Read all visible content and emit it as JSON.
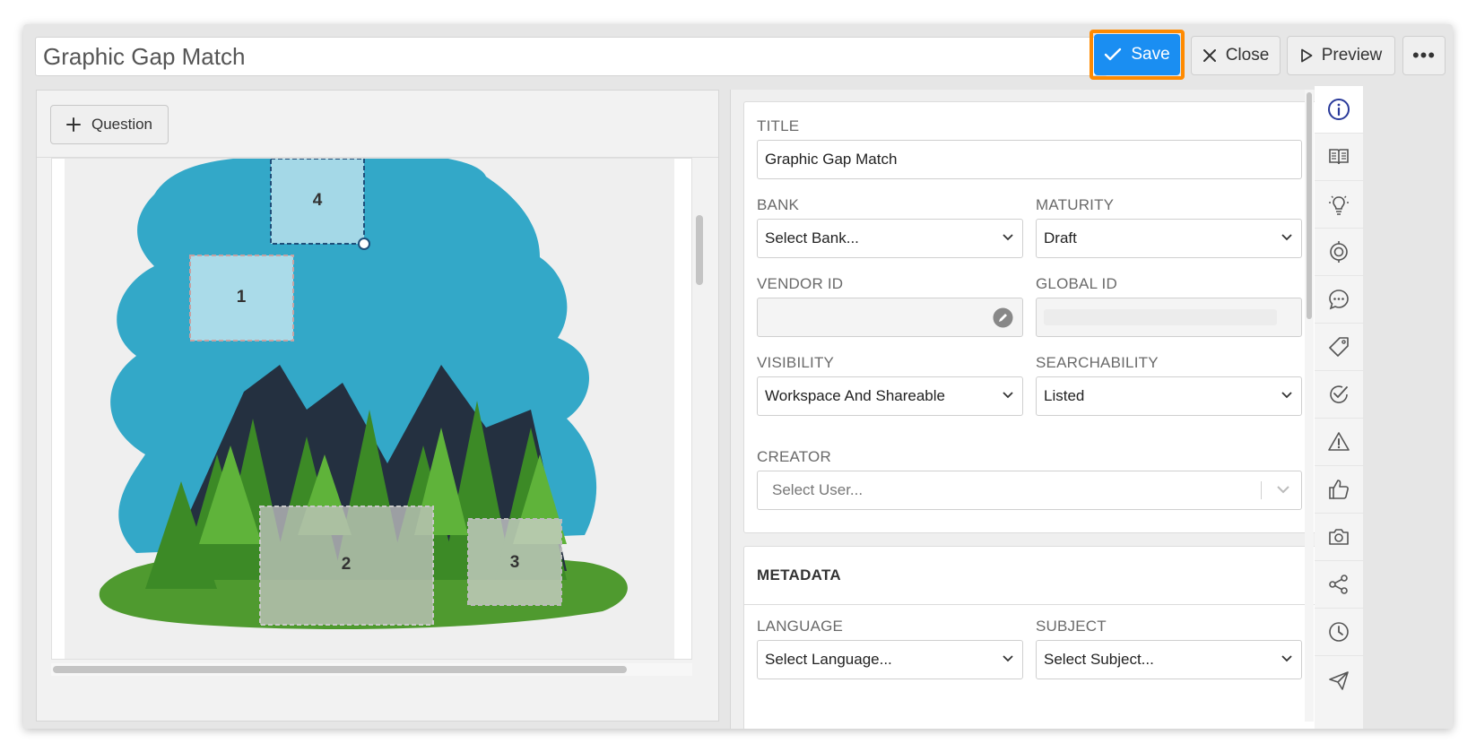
{
  "header": {
    "title": "Graphic Gap Match",
    "save_label": "Save",
    "close_label": "Close",
    "preview_label": "Preview",
    "more_label": "•••"
  },
  "editor": {
    "add_question_label": "Question",
    "hotspots": [
      "4",
      "1",
      "2",
      "3"
    ]
  },
  "properties": {
    "title_label": "TITLE",
    "title_value": "Graphic Gap Match",
    "bank_label": "BANK",
    "bank_value": "Select Bank...",
    "maturity_label": "MATURITY",
    "maturity_value": "Draft",
    "vendor_id_label": "VENDOR ID",
    "vendor_id_value": "",
    "global_id_label": "GLOBAL ID",
    "visibility_label": "VISIBILITY",
    "visibility_value": "Workspace And Shareable",
    "searchability_label": "SEARCHABILITY",
    "searchability_value": "Listed",
    "creator_label": "CREATOR",
    "creator_placeholder": "Select User..."
  },
  "metadata": {
    "title": "METADATA",
    "language_label": "LANGUAGE",
    "language_value": "Select Language...",
    "subject_label": "SUBJECT",
    "subject_value": "Select Subject..."
  },
  "rail": {
    "items": [
      "info-icon",
      "book-icon",
      "lightbulb-icon",
      "target-icon",
      "comment-icon",
      "tag-icon",
      "check-circle-icon",
      "warning-icon",
      "thumbs-up-icon",
      "camera-icon",
      "share-icon",
      "clock-icon",
      "send-icon"
    ],
    "active": "info-icon",
    "accent": "#2a3a9a"
  },
  "colors": {
    "save": "#1a8ef2",
    "highlight": "#ff8a00"
  }
}
